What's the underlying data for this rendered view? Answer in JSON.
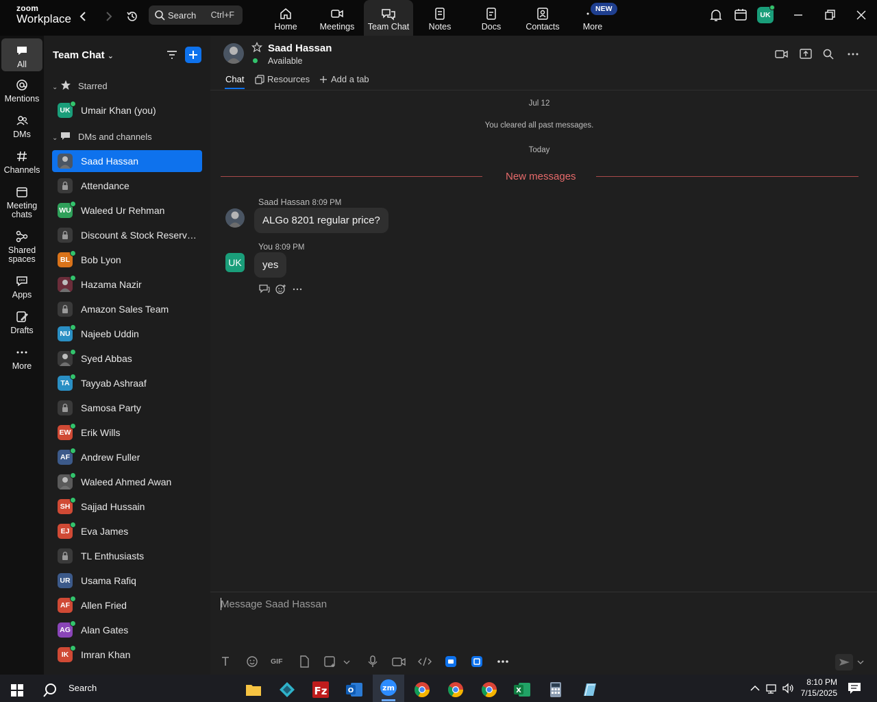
{
  "app": {
    "logo_top": "zoom",
    "logo_bottom": "Workplace"
  },
  "search": {
    "label": "Search",
    "shortcut": "Ctrl+F"
  },
  "nav_tabs": [
    {
      "label": "Home",
      "icon": "home-icon"
    },
    {
      "label": "Meetings",
      "icon": "video-icon"
    },
    {
      "label": "Team Chat",
      "icon": "chat-icon",
      "active": true
    },
    {
      "label": "Notes",
      "icon": "notes-icon"
    },
    {
      "label": "Docs",
      "icon": "docs-icon"
    },
    {
      "label": "Contacts",
      "icon": "contacts-icon"
    },
    {
      "label": "More",
      "icon": "more-icon"
    }
  ],
  "new_badge": "NEW",
  "user": {
    "initials": "UK",
    "color": "#1a9e7a"
  },
  "rail": [
    {
      "label": "All",
      "icon": "chat-bubble-icon",
      "active": true
    },
    {
      "label": "Mentions",
      "icon": "at-icon"
    },
    {
      "label": "DMs",
      "icon": "people-icon"
    },
    {
      "label": "Channels",
      "icon": "hash-icon"
    },
    {
      "label": "Meeting chats",
      "icon": "calendar-icon"
    },
    {
      "label": "Shared spaces",
      "icon": "shared-icon"
    },
    {
      "label": "Apps",
      "icon": "apps-icon"
    },
    {
      "label": "Drafts",
      "icon": "drafts-icon"
    },
    {
      "label": "More",
      "icon": "ellipsis-icon"
    }
  ],
  "sidebar": {
    "title": "Team Chat",
    "starred_label": "Starred",
    "dms_label": "DMs and channels",
    "starred": [
      {
        "name": "Umair Khan (you)",
        "initials": "UK",
        "color": "#1a9e7a",
        "online": true
      }
    ],
    "items": [
      {
        "name": "Saad Hassan",
        "type": "photo",
        "color": "#4a5563",
        "online": false,
        "selected": true
      },
      {
        "name": "Attendance",
        "type": "lock"
      },
      {
        "name": "Waleed Ur Rehman",
        "initials": "WU",
        "color": "#2fa05a",
        "online": true
      },
      {
        "name": "Discount & Stock Reservati...",
        "type": "lock"
      },
      {
        "name": "Bob Lyon",
        "initials": "BL",
        "color": "#d9731a",
        "online": true
      },
      {
        "name": "Hazama Nazir",
        "type": "photo",
        "color": "#6b2d3a",
        "online": true
      },
      {
        "name": "Amazon Sales Team",
        "type": "lock"
      },
      {
        "name": "Najeeb Uddin",
        "initials": "NU",
        "color": "#2a8fc4",
        "online": true
      },
      {
        "name": "Syed Abbas",
        "type": "photo",
        "color": "#3a3a3a",
        "online": true
      },
      {
        "name": "Tayyab Ashraaf",
        "initials": "TA",
        "color": "#2a8fc4",
        "online": true
      },
      {
        "name": "Samosa Party",
        "type": "lock"
      },
      {
        "name": "Erik Wills",
        "initials": "EW",
        "color": "#d04a35",
        "online": true
      },
      {
        "name": "Andrew Fuller",
        "initials": "AF",
        "color": "#3c5a8a",
        "online": true
      },
      {
        "name": "Waleed Ahmed Awan",
        "type": "photo",
        "color": "#5a5a5a",
        "online": true
      },
      {
        "name": "Sajjad Hussain",
        "initials": "SH",
        "color": "#d04a35",
        "online": true
      },
      {
        "name": "Eva James",
        "initials": "EJ",
        "color": "#d04a35",
        "online": true
      },
      {
        "name": "TL Enthusiasts",
        "type": "lock"
      },
      {
        "name": "Usama Rafiq",
        "initials": "UR",
        "color": "#3c5a8a",
        "online": false
      },
      {
        "name": "Allen Fried",
        "initials": "AF",
        "color": "#d04a35",
        "online": true
      },
      {
        "name": "Alan Gates",
        "initials": "AG",
        "color": "#8a45b8",
        "online": true
      },
      {
        "name": "Imran Khan",
        "initials": "IK",
        "color": "#d04a35",
        "online": true
      }
    ]
  },
  "chat": {
    "contact_name": "Saad Hassan",
    "contact_status": "Available",
    "tabs": {
      "chat": "Chat",
      "resources": "Resources",
      "add": "Add a tab"
    },
    "date_label": "Jul 12",
    "cleared_text": "You cleared all past messages.",
    "today_label": "Today",
    "new_messages": "New messages",
    "messages": [
      {
        "sender": "Saad Hassan",
        "time": "8:09 PM",
        "text": "ALGo 8201 regular price?"
      },
      {
        "sender": "You",
        "time": "8:09 PM",
        "text": "yes",
        "initials": "UK"
      }
    ],
    "composer_placeholder": "Message Saad Hassan"
  },
  "taskbar": {
    "search_label": "Search",
    "time": "8:10 PM",
    "date": "7/15/2025"
  }
}
